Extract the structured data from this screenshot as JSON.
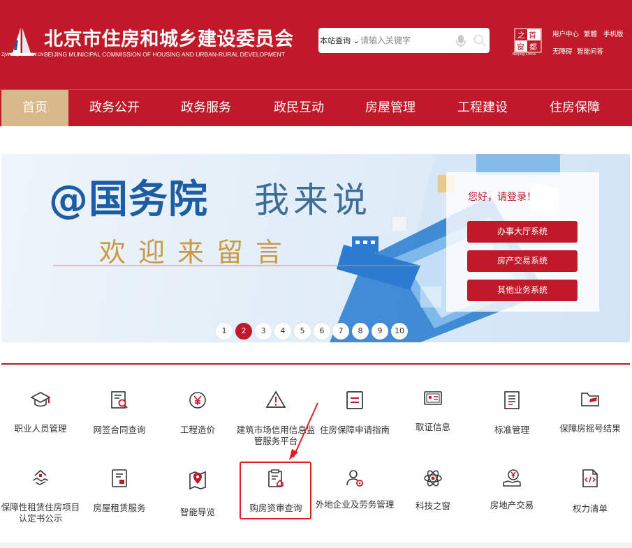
{
  "header": {
    "title": "北京市住房和城乡建设委员会",
    "subtitle": "BEIJING MUNICIPAL COMMISSION OF HOUSING AND URBAN-RURAL DEVELOPMENT",
    "logo_url": "ZJW.BEIJING.GOV.CN",
    "search_scope": "本站查询",
    "search_placeholder": "请输入关键字",
    "capital_caption": "Beijing·China",
    "links": [
      "用户中心",
      "繁體",
      "手机版",
      "无障碍",
      "智能问答"
    ]
  },
  "nav": {
    "items": [
      "首页",
      "政务公开",
      "政务服务",
      "政民互动",
      "房屋管理",
      "工程建设",
      "住房保障"
    ],
    "active": 0
  },
  "banner": {
    "title_a": "@国务院",
    "title_b": "我来说",
    "subtitle": "欢迎来留言",
    "greeting": "您好，请登录！",
    "buttons": [
      "办事大厅系统",
      "房产交易系统",
      "其他业务系统"
    ],
    "pages": [
      "1",
      "2",
      "3",
      "4",
      "5",
      "6",
      "7",
      "8",
      "9",
      "10"
    ],
    "active_page": 1
  },
  "services_row1": [
    {
      "label": "职业人员管理",
      "icon": "graduation-cap-icon"
    },
    {
      "label": "网签合同查询",
      "icon": "document-search-icon"
    },
    {
      "label": "工程造价",
      "icon": "yuan-coin-icon"
    },
    {
      "label": "建筑市场信用信息监管服务平台",
      "icon": "warning-triangle-icon"
    },
    {
      "label": "住房保障申请指南",
      "icon": "guide-book-icon"
    },
    {
      "label": "取证信息",
      "icon": "id-card-icon"
    },
    {
      "label": "标准管理",
      "icon": "list-document-icon"
    },
    {
      "label": "保障房摇号结果",
      "icon": "folder-icon"
    }
  ],
  "services_row2": [
    {
      "label": "保障性租赁住房项目认定书公示",
      "icon": "house-handshake-icon"
    },
    {
      "label": "房屋租赁服务",
      "icon": "rental-document-icon"
    },
    {
      "label": "智能导览",
      "icon": "map-pin-icon"
    },
    {
      "label": "购房资审查询",
      "icon": "clipboard-house-icon"
    },
    {
      "label": "外地企业及劳务管理",
      "icon": "user-gear-icon"
    },
    {
      "label": "科技之窗",
      "icon": "atom-icon"
    },
    {
      "label": "房地产交易",
      "icon": "money-hand-icon"
    },
    {
      "label": "权力清单",
      "icon": "code-file-icon"
    }
  ],
  "colors": {
    "brand_red": "#c0192a",
    "nav_active": "#d7b98c",
    "banner_blue": "#1d5da3",
    "banner_gold": "#c99b48",
    "highlight": "#e02020"
  }
}
